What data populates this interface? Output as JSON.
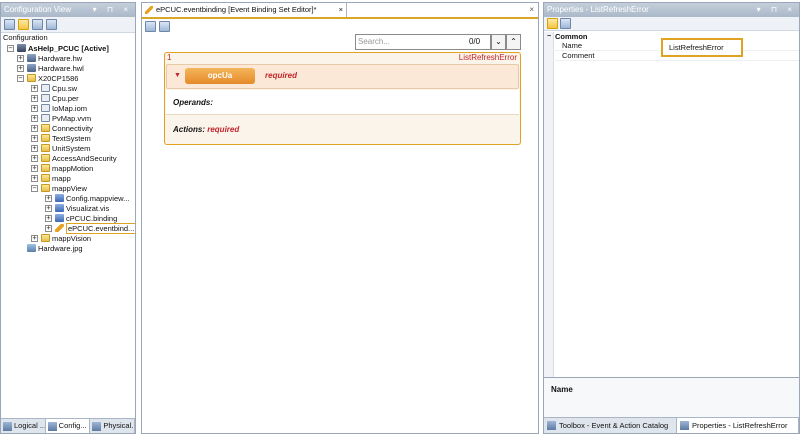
{
  "config_pane": {
    "title": "Configuration View",
    "controls": "▾ ⊓ ×",
    "section_label": "Configuration",
    "tree": [
      {
        "label": "AsHelp_PCUC [Active]",
        "icon": "project-icon",
        "expander": "−",
        "bold": true
      },
      {
        "label": "Hardware.hw",
        "icon": "hardware-icon",
        "expander": "+"
      },
      {
        "label": "Hardware.hwl",
        "icon": "hardware-icon",
        "expander": "+"
      },
      {
        "label": "X20CP1586",
        "icon": "folder-icon",
        "expander": "−"
      },
      {
        "label": "Cpu.sw",
        "icon": "file-icon",
        "expander": "+"
      },
      {
        "label": "Cpu.per",
        "icon": "file-icon",
        "expander": "+"
      },
      {
        "label": "IoMap.iom",
        "icon": "file-icon",
        "expander": "+"
      },
      {
        "label": "PvMap.vvm",
        "icon": "file-icon",
        "expander": "+"
      },
      {
        "label": "Connectivity",
        "icon": "folder-icon",
        "expander": "+"
      },
      {
        "label": "TextSystem",
        "icon": "folder-icon",
        "expander": "+"
      },
      {
        "label": "UnitSystem",
        "icon": "folder-icon",
        "expander": "+"
      },
      {
        "label": "AccessAndSecurity",
        "icon": "folder-icon",
        "expander": "+"
      },
      {
        "label": "mappMotion",
        "icon": "folder-icon",
        "expander": "+"
      },
      {
        "label": "mapp",
        "icon": "folder-icon",
        "expander": "+"
      },
      {
        "label": "mappView",
        "icon": "folder-icon",
        "expander": "−"
      },
      {
        "label": "Config.mappview...",
        "icon": "system-icon",
        "expander": "+"
      },
      {
        "label": "Visualizat.vis",
        "icon": "system-icon",
        "expander": "+"
      },
      {
        "label": "cPCUC.binding",
        "icon": "binding-icon",
        "expander": "+"
      },
      {
        "label": "ePCUC.eventbind...",
        "icon": "pencil-icon",
        "expander": "+",
        "selected": true
      },
      {
        "label": "mappVision",
        "icon": "folder-icon",
        "expander": "+"
      },
      {
        "label": "Hardware.jpg",
        "icon": "image-icon",
        "expander": ""
      }
    ],
    "bottom_tabs": [
      {
        "label": "Logical ..."
      },
      {
        "label": "Config..."
      },
      {
        "label": "Physical..."
      }
    ]
  },
  "editor": {
    "tab_title": "ePCUC.eventbinding [Event Binding Set Editor]*",
    "tab_close": "×",
    "pane_close": "×",
    "search": {
      "placeholder": "Search...",
      "count": "0/0",
      "down": "⌄",
      "up": "⌃"
    },
    "binding": {
      "index": "1",
      "name": "ListRefreshError",
      "event_source": "opcUa",
      "event_status": "required",
      "operands_label": "Operands:",
      "actions_label": "Actions:",
      "actions_status": "required"
    }
  },
  "properties": {
    "title": "Properties - ListRefreshError",
    "controls": "▾ ⊓ ×",
    "category": "Common",
    "rows": [
      {
        "name": "Name",
        "value": "ListRefreshError"
      },
      {
        "name": "Comment",
        "value": ""
      }
    ],
    "description_title": "Name",
    "bottom_tabs": [
      {
        "label": "Toolbox - Event & Action Catalog"
      },
      {
        "label": "Properties - ListRefreshError"
      }
    ]
  }
}
